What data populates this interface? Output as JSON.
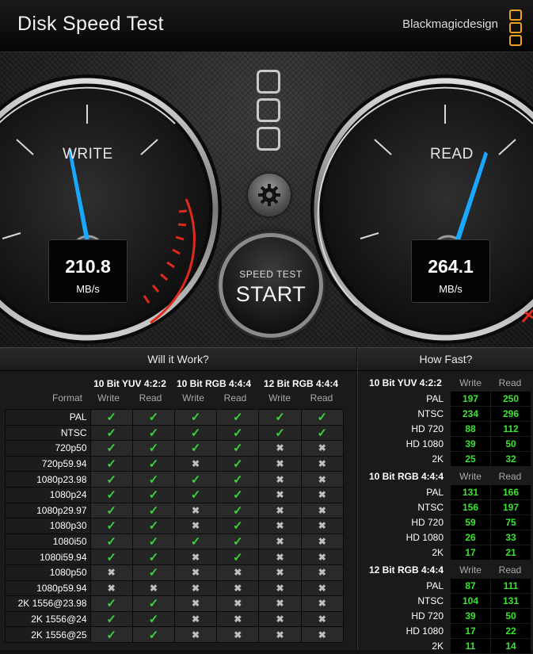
{
  "app": {
    "title": "Disk Speed Test",
    "brand": "Blackmagicdesign"
  },
  "gauges": {
    "write": {
      "label": "WRITE",
      "value": "210.8",
      "unit": "MB/s"
    },
    "read": {
      "label": "READ",
      "value": "264.1",
      "unit": "MB/s"
    }
  },
  "start": {
    "top": "SPEED TEST",
    "main": "START"
  },
  "will_it_work": {
    "title": "Will it Work?",
    "format_header": "Format",
    "groups": [
      "10 Bit YUV 4:2:2",
      "10 Bit RGB 4:4:4",
      "12 Bit RGB 4:4:4"
    ],
    "sub": [
      "Write",
      "Read"
    ],
    "rows": [
      {
        "format": "PAL",
        "marks": [
          1,
          1,
          1,
          1,
          1,
          1
        ]
      },
      {
        "format": "NTSC",
        "marks": [
          1,
          1,
          1,
          1,
          1,
          1
        ]
      },
      {
        "format": "720p50",
        "marks": [
          1,
          1,
          1,
          1,
          0,
          0
        ]
      },
      {
        "format": "720p59.94",
        "marks": [
          1,
          1,
          0,
          1,
          0,
          0
        ]
      },
      {
        "format": "1080p23.98",
        "marks": [
          1,
          1,
          1,
          1,
          0,
          0
        ]
      },
      {
        "format": "1080p24",
        "marks": [
          1,
          1,
          1,
          1,
          0,
          0
        ]
      },
      {
        "format": "1080p29.97",
        "marks": [
          1,
          1,
          0,
          1,
          0,
          0
        ]
      },
      {
        "format": "1080p30",
        "marks": [
          1,
          1,
          0,
          1,
          0,
          0
        ]
      },
      {
        "format": "1080i50",
        "marks": [
          1,
          1,
          1,
          1,
          0,
          0
        ]
      },
      {
        "format": "1080i59.94",
        "marks": [
          1,
          1,
          0,
          1,
          0,
          0
        ]
      },
      {
        "format": "1080p50",
        "marks": [
          0,
          1,
          0,
          0,
          0,
          0
        ]
      },
      {
        "format": "1080p59.94",
        "marks": [
          0,
          0,
          0,
          0,
          0,
          0
        ]
      },
      {
        "format": "2K 1556@23.98",
        "marks": [
          1,
          1,
          0,
          0,
          0,
          0
        ]
      },
      {
        "format": "2K 1556@24",
        "marks": [
          1,
          1,
          0,
          0,
          0,
          0
        ]
      },
      {
        "format": "2K 1556@25",
        "marks": [
          1,
          1,
          0,
          0,
          0,
          0
        ]
      }
    ]
  },
  "how_fast": {
    "title": "How Fast?",
    "col_write": "Write",
    "col_read": "Read",
    "sections": [
      {
        "name": "10 Bit YUV 4:2:2",
        "rows": [
          {
            "format": "PAL",
            "write": "197",
            "read": "250"
          },
          {
            "format": "NTSC",
            "write": "234",
            "read": "296"
          },
          {
            "format": "HD 720",
            "write": "88",
            "read": "112"
          },
          {
            "format": "HD 1080",
            "write": "39",
            "read": "50"
          },
          {
            "format": "2K",
            "write": "25",
            "read": "32"
          }
        ]
      },
      {
        "name": "10 Bit RGB 4:4:4",
        "rows": [
          {
            "format": "PAL",
            "write": "131",
            "read": "166"
          },
          {
            "format": "NTSC",
            "write": "156",
            "read": "197"
          },
          {
            "format": "HD 720",
            "write": "59",
            "read": "75"
          },
          {
            "format": "HD 1080",
            "write": "26",
            "read": "33"
          },
          {
            "format": "2K",
            "write": "17",
            "read": "21"
          }
        ]
      },
      {
        "name": "12 Bit RGB 4:4:4",
        "rows": [
          {
            "format": "PAL",
            "write": "87",
            "read": "111"
          },
          {
            "format": "NTSC",
            "write": "104",
            "read": "131"
          },
          {
            "format": "HD 720",
            "write": "39",
            "read": "50"
          },
          {
            "format": "HD 1080",
            "write": "17",
            "read": "22"
          },
          {
            "format": "2K",
            "write": "11",
            "read": "14"
          }
        ]
      }
    ]
  },
  "colors": {
    "accent_needle": "#1aa8ff",
    "good": "#39d43a",
    "value_green": "#39e52e",
    "warn_red": "#e02a1a",
    "logo_orange": "#f0a020"
  }
}
